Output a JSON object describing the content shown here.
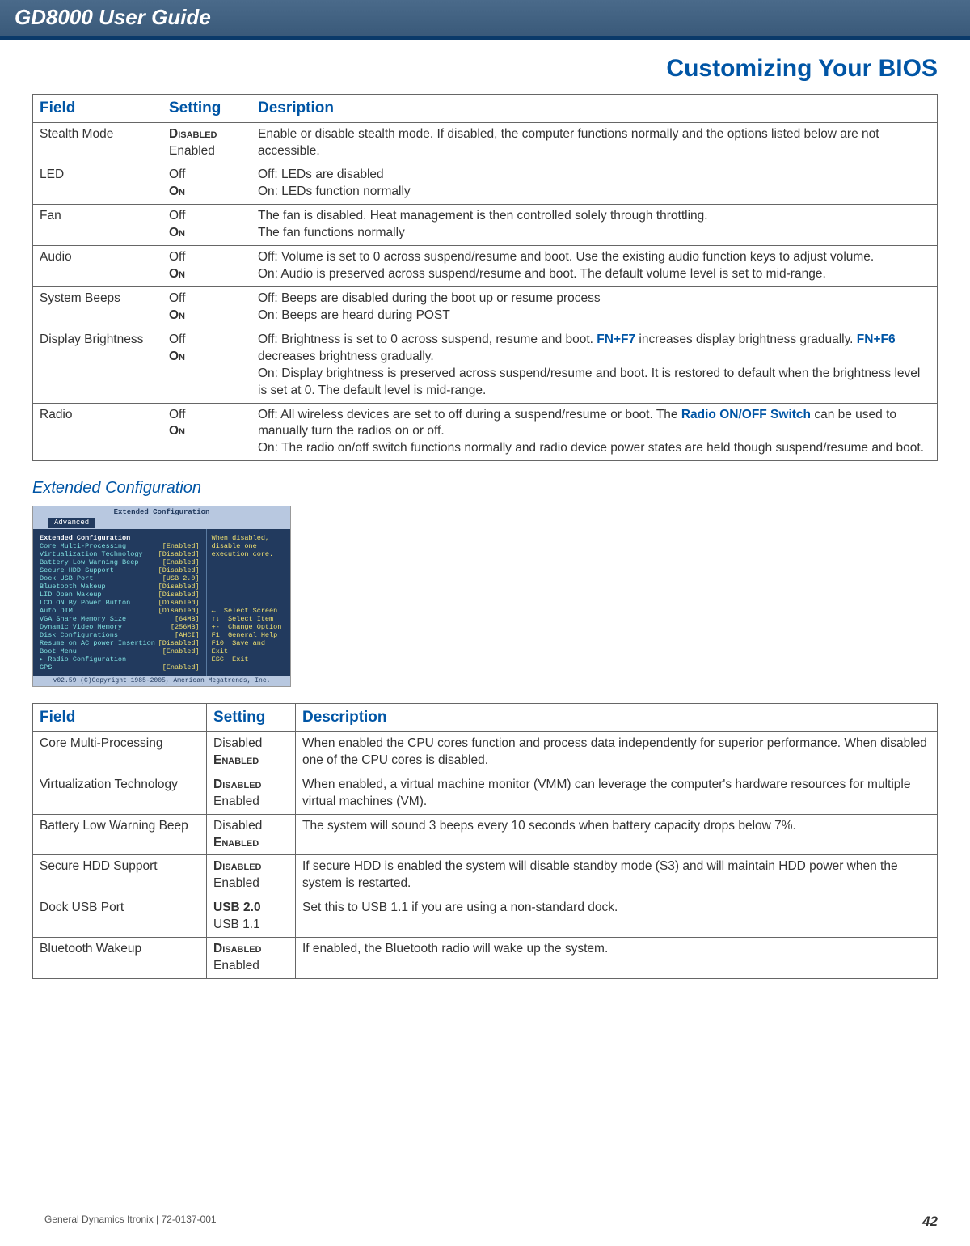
{
  "header": {
    "title": "GD8000 User Guide"
  },
  "section_title": "Customizing Your BIOS",
  "table1": {
    "headers": {
      "field": "Field",
      "setting": "Setting",
      "desc": "Desription"
    },
    "rows": [
      {
        "field": "Stealth Mode",
        "s1": "Disabled",
        "s2": "Enabled",
        "desc": "Enable or disable stealth mode. If disabled, the computer functions normally and the options listed below are not accessible."
      },
      {
        "field": "LED",
        "s1": "Off",
        "s2": "On",
        "d1": "Off: LEDs are disabled",
        "d2": "On: LEDs function normally"
      },
      {
        "field": "Fan",
        "s1": "Off",
        "s2": "On",
        "d1": "The fan is disabled. Heat management is then controlled solely through throttling.",
        "d2": "The fan functions normally"
      },
      {
        "field": "Audio",
        "s1": "Off",
        "s2": "On",
        "d1": "Off: Volume is set to 0 across suspend/resume and boot. Use the existing audio function keys to adjust volume.",
        "d2": "On: Audio is preserved across suspend/resume and boot. The default volume level is set to mid-range."
      },
      {
        "field": "System Beeps",
        "s1": "Off",
        "s2": "On",
        "d1": "Off: Beeps are disabled during the boot up or resume process",
        "d2": "On: Beeps are heard during POST"
      },
      {
        "field": "Display Brightness",
        "s1": "Off",
        "s2": "On",
        "d1a": "Off: Brightness is set to 0 across suspend, resume and boot.  ",
        "d1b": "FN+F7",
        "d1c": " increases display brightness gradually. ",
        "d1d": "FN+F6",
        "d1e": " decreases brightness gradually.",
        "d2": "On: Display brightness is preserved across suspend/resume and boot. It is restored to default when the brightness level is set at 0. The default level is mid-range."
      },
      {
        "field": "Radio",
        "s1": "Off",
        "s2": "On",
        "d1a": "Off: All wireless devices are set to off during a suspend/resume or boot.  The ",
        "d1b": "Radio ON/OFF Switch",
        "d1c": " can be used to manually turn the radios on or off.",
        "d2": "On: The radio on/off switch functions normally and radio device power states are held though suspend/resume and boot."
      }
    ]
  },
  "subhead": "Extended Configuration",
  "bios": {
    "top": "Extended Configuration",
    "tab": "Advanced",
    "heading": "Extended Configuration",
    "help": "When disabled, disable one execution core.",
    "items": [
      {
        "k": "Core Multi-Processing",
        "v": "[Enabled]"
      },
      {
        "k": "Virtualization Technology",
        "v": "[Disabled]"
      },
      {
        "k": "Battery Low Warning Beep",
        "v": "[Enabled]"
      },
      {
        "k": "Secure HDD Support",
        "v": "[Disabled]"
      },
      {
        "k": "Dock USB Port",
        "v": "[USB 2.0]"
      },
      {
        "k": "",
        "v": ""
      },
      {
        "k": "Bluetooth Wakeup",
        "v": "[Disabled]"
      },
      {
        "k": "LID Open Wakeup",
        "v": "[Disabled]"
      },
      {
        "k": "LCD ON By Power Button",
        "v": "[Disabled]"
      },
      {
        "k": "Auto DIM",
        "v": "[Disabled]"
      },
      {
        "k": "VGA Share Memory Size",
        "v": "[64MB]"
      },
      {
        "k": "Dynamic Video Memory",
        "v": "[256MB]"
      },
      {
        "k": "Disk Configurations",
        "v": "[AHCI]"
      },
      {
        "k": "Resume on AC power Insertion",
        "v": "[Disabled]"
      },
      {
        "k": "Boot Menu",
        "v": "[Enabled]"
      },
      {
        "k": "",
        "v": ""
      },
      {
        "k": "▸ Radio Configuration",
        "v": ""
      },
      {
        "k": "GPS",
        "v": "[Enabled]"
      }
    ],
    "nav": [
      {
        "k": "←",
        "v": "Select Screen"
      },
      {
        "k": "↑↓",
        "v": "Select Item"
      },
      {
        "k": "+-",
        "v": "Change Option"
      },
      {
        "k": "F1",
        "v": "General Help"
      },
      {
        "k": "F10",
        "v": "Save and Exit"
      },
      {
        "k": "ESC",
        "v": "Exit"
      }
    ],
    "foot": "v02.59 (C)Copyright 1985-2005, American Megatrends, Inc."
  },
  "table2": {
    "headers": {
      "field": "Field",
      "setting": "Setting",
      "desc": "Description"
    },
    "rows": [
      {
        "field": "Core Multi-Processing",
        "s1": "Disabled",
        "s2": "Enabled",
        "bold": "s2",
        "desc": "When enabled the CPU cores function and process data independently for superior performance.  When disabled one of the CPU cores is disabled."
      },
      {
        "field": "Virtualization Technology",
        "s1": "Disabled",
        "s2": "Enabled",
        "bold": "s1",
        "desc": "When enabled, a virtual machine monitor (VMM) can leverage the computer's hardware resources for multiple virtual machines (VM)."
      },
      {
        "field": "Battery Low Warning Beep",
        "s1": "Disabled",
        "s2": "Enabled",
        "bold": "s2",
        "desc": "The system will sound 3 beeps every 10 seconds when battery capacity drops below 7%."
      },
      {
        "field": "Secure HDD Support",
        "s1": "Disabled",
        "s2": "Enabled",
        "bold": "s1",
        "desc": "If secure HDD is enabled the system will disable standby mode (S3) and will maintain HDD power when the system is restarted."
      },
      {
        "field": "Dock USB Port",
        "s1": "USB 2.0",
        "s2": "USB 1.1",
        "bold": "s1",
        "desc": "Set this to USB 1.1 if you are using a non-standard dock."
      },
      {
        "field": "Bluetooth Wakeup",
        "s1": "Disabled",
        "s2": "Enabled",
        "bold": "s1",
        "desc": "If enabled, the Bluetooth radio will wake up the system."
      }
    ]
  },
  "footer": {
    "left": "General Dynamics Itronix | 72-0137-001",
    "page": "42"
  },
  "chart_data": {
    "type": "table",
    "tables": [
      {
        "title": "Stealth Mode Options",
        "columns": [
          "Field",
          "Setting",
          "Description"
        ],
        "rows": [
          [
            "Stealth Mode",
            "DISABLED / Enabled",
            "Enable or disable stealth mode. If disabled, the computer functions normally and the options listed below are not accessible."
          ],
          [
            "LED",
            "Off / ON",
            "Off: LEDs are disabled. On: LEDs function normally"
          ],
          [
            "Fan",
            "Off / ON",
            "The fan is disabled; heat management via throttling. / The fan functions normally"
          ],
          [
            "Audio",
            "Off / ON",
            "Off: Volume 0 across suspend/resume/boot. On: Audio preserved; default mid-range."
          ],
          [
            "System Beeps",
            "Off / ON",
            "Off: Beeps disabled during boot/resume. On: Beeps heard during POST"
          ],
          [
            "Display Brightness",
            "Off / ON",
            "Off: Brightness 0; FN+F7/FN+F6 adjust. On: Brightness preserved; default mid-range."
          ],
          [
            "Radio",
            "Off / ON",
            "Off: Wireless off; Radio ON/OFF Switch toggles. On: Switch functions normally; states held."
          ]
        ]
      },
      {
        "title": "Extended Configuration",
        "columns": [
          "Field",
          "Setting",
          "Description"
        ],
        "rows": [
          [
            "Core Multi-Processing",
            "Disabled / ENABLED",
            "When enabled CPU cores process independently. When disabled one core is disabled."
          ],
          [
            "Virtualization Technology",
            "DISABLED / Enabled",
            "When enabled a VMM can leverage hardware for multiple VMs."
          ],
          [
            "Battery Low Warning Beep",
            "Disabled / ENABLED",
            "System sounds 3 beeps every 10 s when battery < 7%."
          ],
          [
            "Secure HDD Support",
            "DISABLED / Enabled",
            "If enabled, disables standby (S3) and maintains HDD power on restart."
          ],
          [
            "Dock USB Port",
            "USB 2.0 / USB 1.1",
            "Set to USB 1.1 if using a non-standard dock."
          ],
          [
            "Bluetooth Wakeup",
            "DISABLED / Enabled",
            "If enabled, Bluetooth radio will wake the system."
          ]
        ]
      }
    ]
  }
}
